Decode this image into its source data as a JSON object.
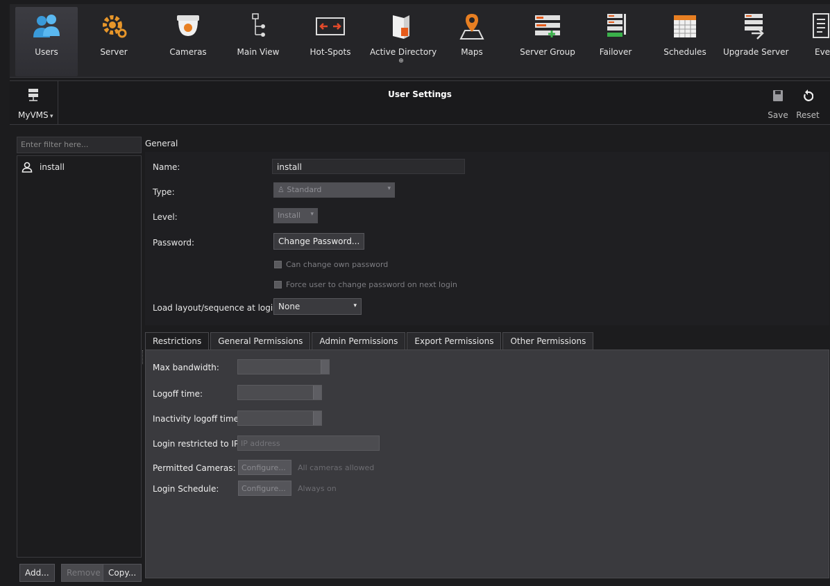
{
  "toolbar": {
    "items": [
      {
        "label": "Users",
        "icon": "users-icon"
      },
      {
        "label": "Server",
        "icon": "server-gear-icon"
      },
      {
        "label": "Cameras",
        "icon": "dome-camera-icon"
      },
      {
        "label": "Main View",
        "icon": "tree-view-icon"
      },
      {
        "label": "Hot-Spots",
        "icon": "hotspot-icon"
      },
      {
        "label": "Active Directory",
        "sub": "⊕",
        "icon": "active-directory-icon"
      },
      {
        "label": "Maps",
        "icon": "map-pin-icon"
      },
      {
        "label": "Server Group",
        "icon": "server-group-icon"
      },
      {
        "label": "Failover",
        "icon": "failover-icon"
      },
      {
        "label": "Schedules",
        "icon": "calendar-icon"
      },
      {
        "label": "Upgrade Server",
        "icon": "upgrade-server-icon"
      },
      {
        "label": "Event",
        "icon": "event-icon"
      }
    ]
  },
  "titlebar": {
    "server_label": "MyVMS",
    "title": "User Settings",
    "save_label": "Save",
    "reset_label": "Reset"
  },
  "left": {
    "filter_placeholder": "Enter filter here...",
    "users": [
      "install"
    ],
    "add_label": "Add...",
    "remove_label": "Remove",
    "copy_label": "Copy..."
  },
  "general": {
    "section_title": "General",
    "name_label": "Name:",
    "name_value": "install",
    "type_label": "Type:",
    "type_value": "Standard",
    "level_label": "Level:",
    "level_value": "Install",
    "password_label": "Password:",
    "change_password_label": "Change Password...",
    "can_change_own": "Can change own password",
    "force_change": "Force user to change password on next login",
    "load_layout_label": "Load layout/sequence at login:",
    "load_layout_value": "None"
  },
  "tabs": [
    "Restrictions",
    "General Permissions",
    "Admin Permissions",
    "Export Permissions",
    "Other Permissions"
  ],
  "restrictions": {
    "max_bandwidth_label": "Max bandwidth:",
    "logoff_time_label": "Logoff time:",
    "inactivity_label": "Inactivity logoff time:",
    "login_ip_label": "Login restricted to IP:",
    "ip_placeholder": "IP address",
    "permitted_cameras_label": "Permitted Cameras:",
    "configure_label": "Configure...",
    "all_cameras": "All cameras allowed",
    "login_schedule_label": "Login Schedule:",
    "always_on": "Always on"
  }
}
